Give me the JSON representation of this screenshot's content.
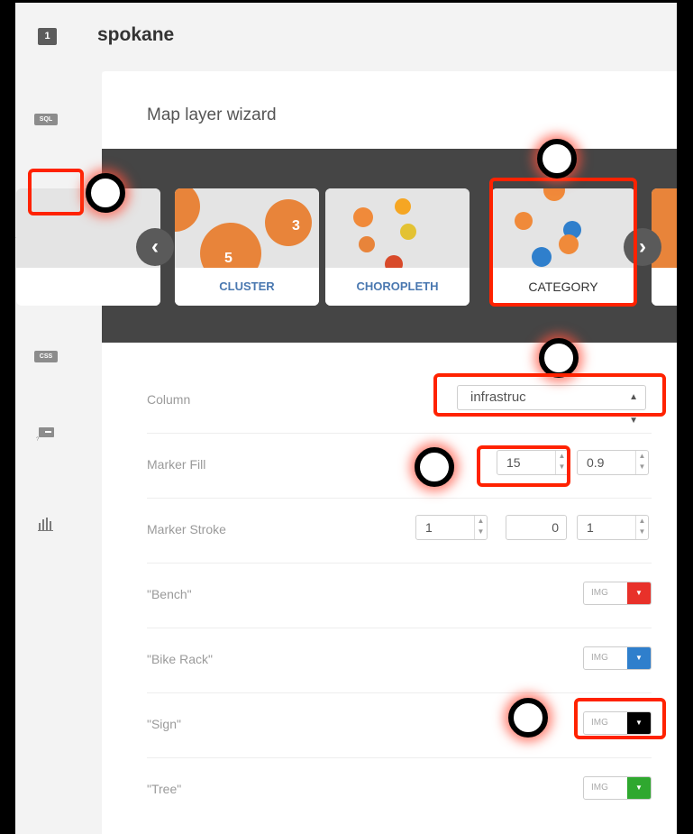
{
  "header": {
    "layer_number": "1",
    "layer_name": "spokane"
  },
  "sidebar": {
    "items": [
      {
        "name": "sql",
        "label": "SQL"
      },
      {
        "name": "wizard",
        "label": ""
      },
      {
        "name": "infowindow",
        "label": ""
      },
      {
        "name": "css",
        "label": "CSS"
      },
      {
        "name": "legend",
        "label": ""
      },
      {
        "name": "filters",
        "label": ""
      }
    ]
  },
  "panel": {
    "title": "Map layer wizard",
    "carousel": {
      "tiles": [
        {
          "label": "CLUSTER",
          "active": false
        },
        {
          "label": "CHOROPLETH",
          "active": false
        },
        {
          "label": "CATEGORY",
          "active": true
        }
      ],
      "prev_glyph": "‹",
      "next_glyph": "›"
    },
    "form": {
      "column": {
        "label": "Column",
        "value": "infrastruc"
      },
      "marker_fill": {
        "label": "Marker Fill",
        "size": "15",
        "opacity": "0.9"
      },
      "marker_stroke": {
        "label": "Marker Stroke",
        "width": "1",
        "color": "0",
        "opacity": "1"
      },
      "categories": [
        {
          "label": "\"Bench\"",
          "img": "IMG",
          "color": "#e8312a"
        },
        {
          "label": "\"Bike Rack\"",
          "img": "IMG",
          "color": "#2f7fcc"
        },
        {
          "label": "\"Sign\"",
          "img": "IMG",
          "color": "#000000"
        },
        {
          "label": "\"Tree\"",
          "img": "IMG",
          "color": "#2fa82f"
        }
      ]
    }
  },
  "colors": {
    "highlight": "#ff2200",
    "carousel_bg": "#454545",
    "cluster_orange": "#e8843a"
  }
}
